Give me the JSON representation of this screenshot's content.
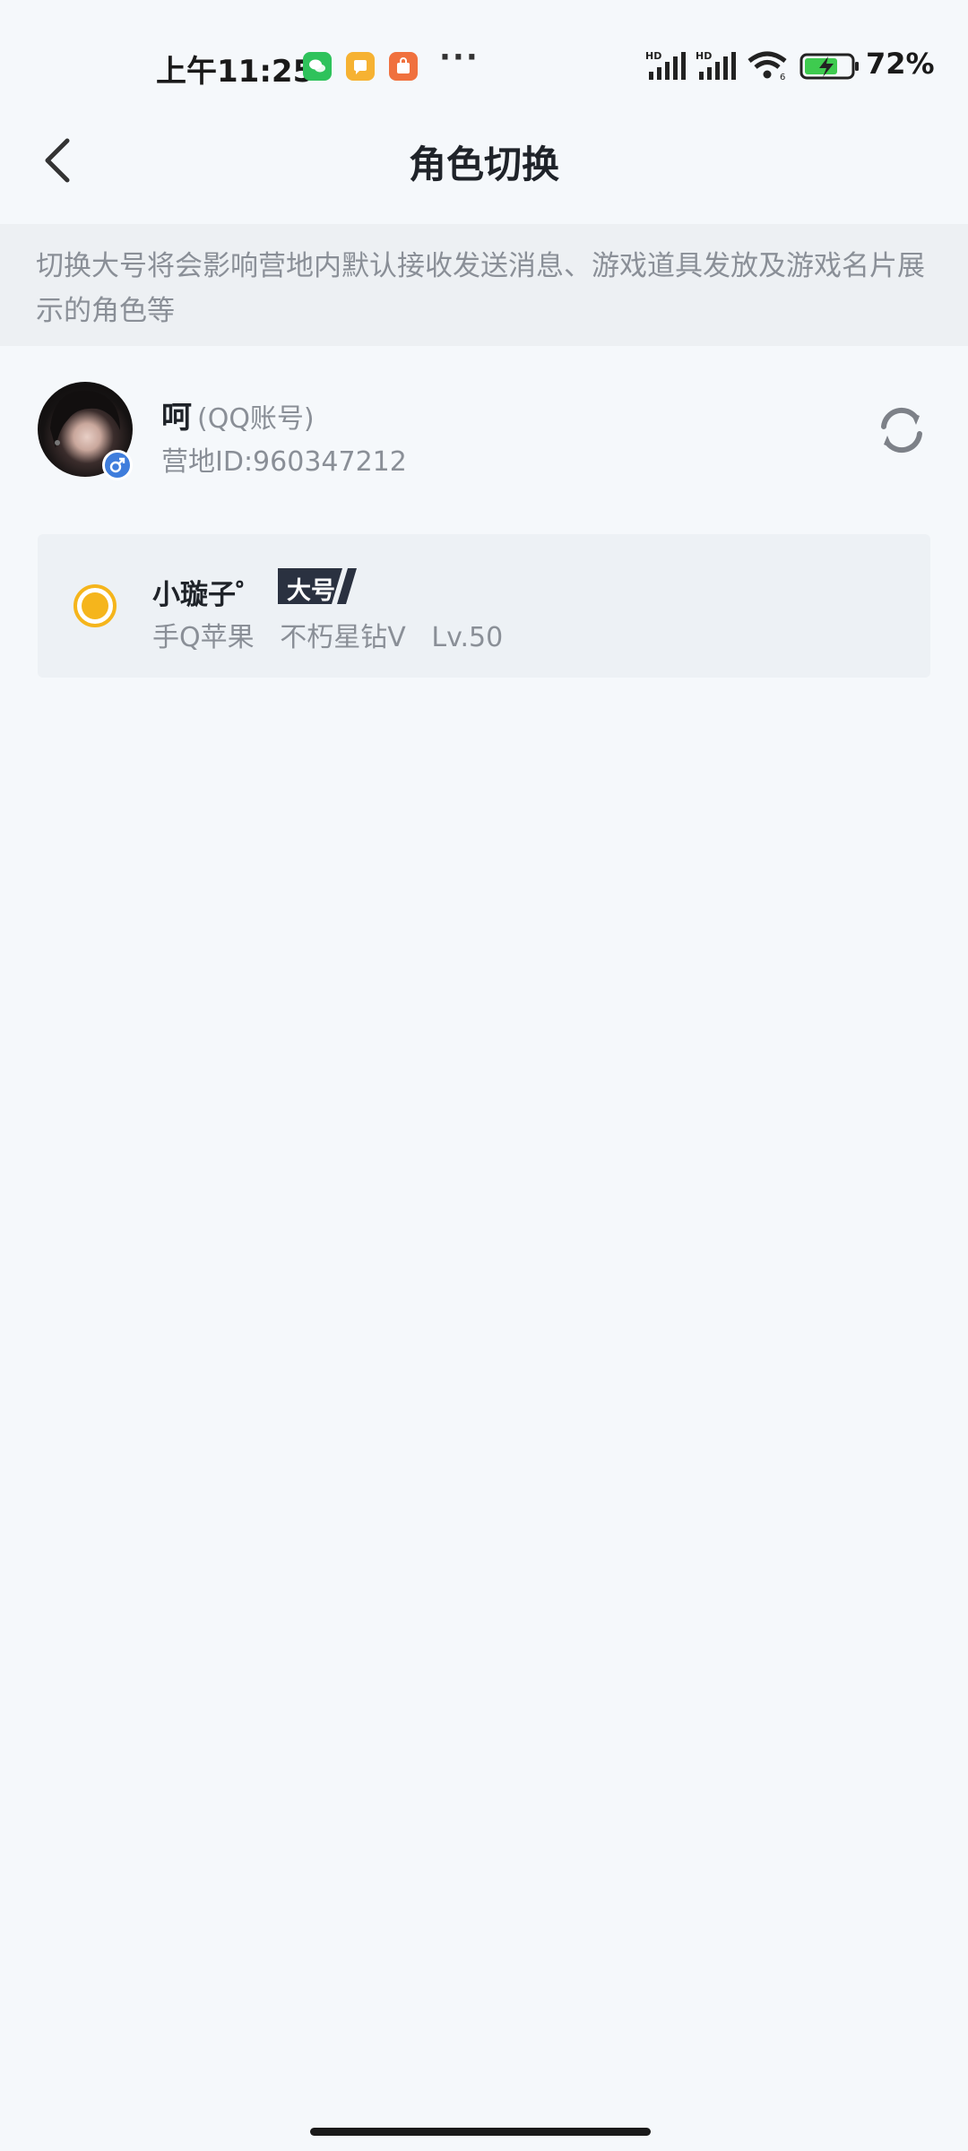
{
  "status_bar": {
    "time": "上午11:25",
    "notification_icons": [
      "wechat-icon",
      "message-icon",
      "shop-icon"
    ],
    "more": "···",
    "battery_percent": "72%"
  },
  "header": {
    "title": "角色切换",
    "back_icon": "chevron-left-icon"
  },
  "notice": {
    "text": "切换大号将会影响营地内默认接收发送消息、游戏道具发放及游戏名片展示的角色等"
  },
  "account": {
    "name": "呵",
    "account_type": "(QQ账号)",
    "camp_id": "营地ID:960347212",
    "gender": "male",
    "refresh_icon": "refresh-icon"
  },
  "roles": [
    {
      "name": "小璇子゜",
      "tag": "大号",
      "info": "手Q苹果   不朽星钻Ⅴ   Lv.50",
      "selected": true
    }
  ],
  "colors": {
    "background": "#f5f8fb",
    "notice_bg": "#edf0f3",
    "radio_selected": "#f5b51c",
    "tag_bg": "#2a3140",
    "gender_badge": "#3f7ddc"
  }
}
